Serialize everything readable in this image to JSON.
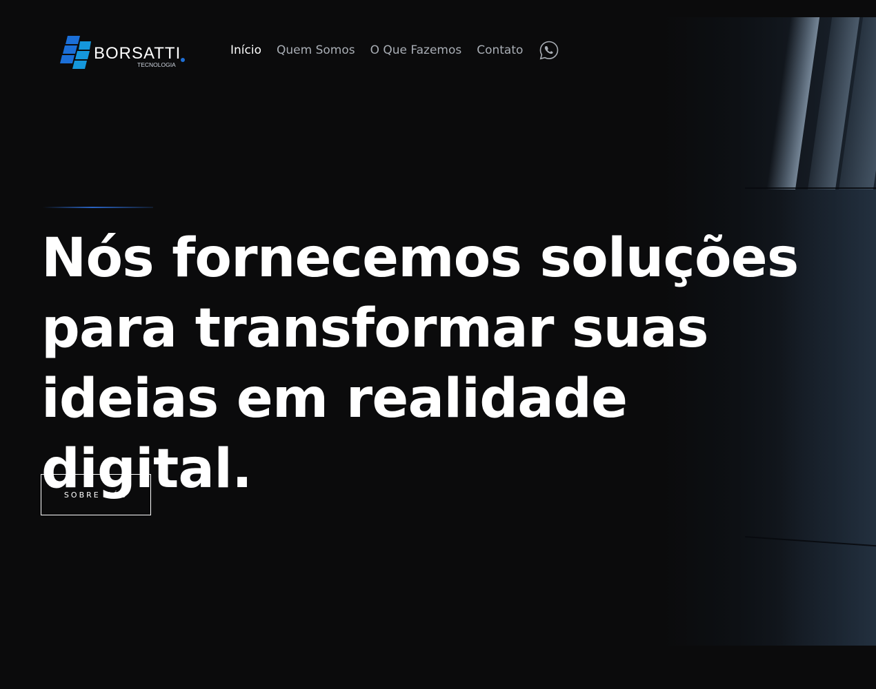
{
  "header": {
    "logo": {
      "name": "BORSATTI",
      "tagline": "TECNOLOGIA",
      "brand_color": "#1f6fd6"
    },
    "nav": {
      "items": [
        {
          "label": "Início",
          "active": true
        },
        {
          "label": "Quem Somos",
          "active": false
        },
        {
          "label": "O Que Fazemos",
          "active": false
        },
        {
          "label": "Contato",
          "active": false
        }
      ],
      "whatsapp_icon": "whatsapp-icon"
    }
  },
  "hero": {
    "headline": "Nós fornecemos soluções para transformar suas ideias em realidade digital.",
    "cta_label": "SOBRE NÓS",
    "accent_color": "#2a64c4"
  },
  "colors": {
    "background": "#0b0b0c",
    "text_primary": "#ffffff",
    "nav_inactive": "#a9aeb5"
  }
}
